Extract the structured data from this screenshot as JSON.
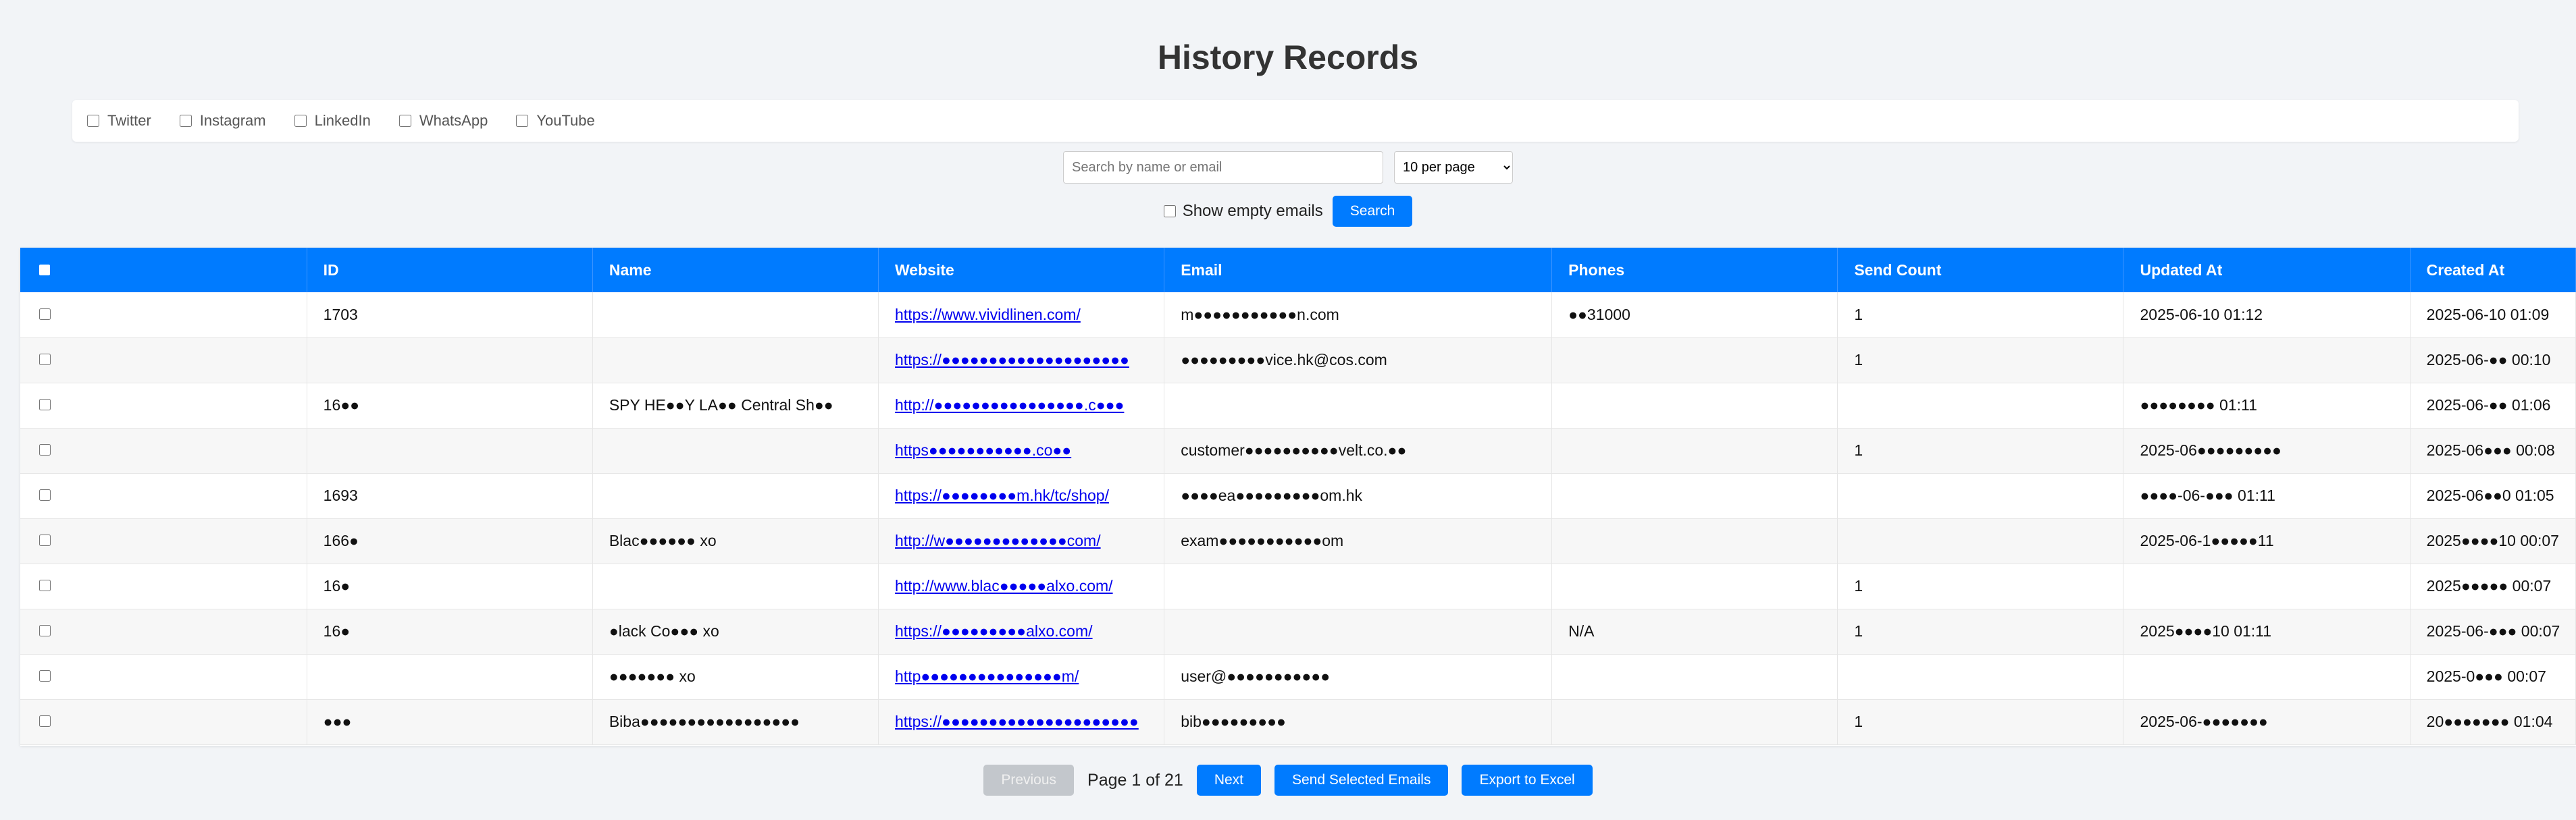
{
  "title": "History Records",
  "filters": [
    "Twitter",
    "Instagram",
    "LinkedIn",
    "WhatsApp",
    "YouTube"
  ],
  "search": {
    "placeholder": "Search by name or email",
    "per_page": "10 per page"
  },
  "show_empty_label": "Show empty emails",
  "search_button": "Search",
  "table": {
    "columns": [
      "ID",
      "Name",
      "Website",
      "Email",
      "Phones",
      "Send Count",
      "Updated At",
      "Created At"
    ],
    "rows": [
      [
        "1703",
        "",
        "https://www.vividlinen.com/",
        "m●●●●●●●●●●●n.com",
        "●●31000",
        "1",
        "2025-06-10 01:12",
        "2025-06-10 01:09"
      ],
      [
        "",
        "",
        "https://●●●●●●●●●●●●●●●●●●●●",
        "●●●●●●●●●vice.hk@cos.com",
        "",
        "1",
        "",
        "2025-06-●● 00:10"
      ],
      [
        "16●●",
        "SPY HE●●Y LA●● Central Sh●●",
        "http://●●●●●●●●●●●●●●●●.c●●●",
        "",
        "",
        "",
        "●●●●●●●● 01:11",
        "2025-06-●● 01:06"
      ],
      [
        "",
        "",
        "https●●●●●●●●●●●.co●●",
        "customer●●●●●●●●●●velt.co.●●",
        "",
        "1",
        "2025-06●●●●●●●●●",
        "2025-06●●● 00:08"
      ],
      [
        "1693",
        "",
        "https://●●●●●●●●m.hk/tc/shop/",
        "●●●●ea●●●●●●●●●om.hk",
        "",
        "",
        "●●●●-06-●●● 01:11",
        "2025-06●●0 01:05"
      ],
      [
        "166●",
        "Blac●●●●●● xo",
        "http://w●●●●●●●●●●●●●com/",
        "exam●●●●●●●●●●●om",
        "",
        "",
        "2025-06-1●●●●●11",
        "2025●●●●10 00:07"
      ],
      [
        "16●",
        "",
        "http://www.blac●●●●●alxo.com/",
        "",
        "",
        "1",
        "",
        "2025●●●●● 00:07"
      ],
      [
        "16●",
        "●lack Co●●● xo",
        "https://●●●●●●●●●alxo.com/",
        "",
        "N/A",
        "1",
        "2025●●●●10 01:11",
        "2025-06-●●● 00:07"
      ],
      [
        "",
        "●●●●●●● xo",
        "http●●●●●●●●●●●●●●●m/",
        "user@●●●●●●●●●●●",
        "",
        "",
        "",
        "2025-0●●● 00:07"
      ],
      [
        "●●●",
        "Biba●●●●●●●●●●●●●●●●●",
        "https://●●●●●●●●●●●●●●●●●●●●●",
        "bib●●●●●●●●●",
        "",
        "1",
        "2025-06-●●●●●●●",
        "20●●●●●●● 01:04"
      ]
    ]
  },
  "pager": {
    "previous": "Previous",
    "info": "Page 1 of 21",
    "next": "Next",
    "send_selected": "Send Selected Emails",
    "export": "Export to Excel"
  },
  "colors": {
    "accent": "#007bff",
    "background": "#f2f4f7",
    "link": "#0000ee"
  }
}
